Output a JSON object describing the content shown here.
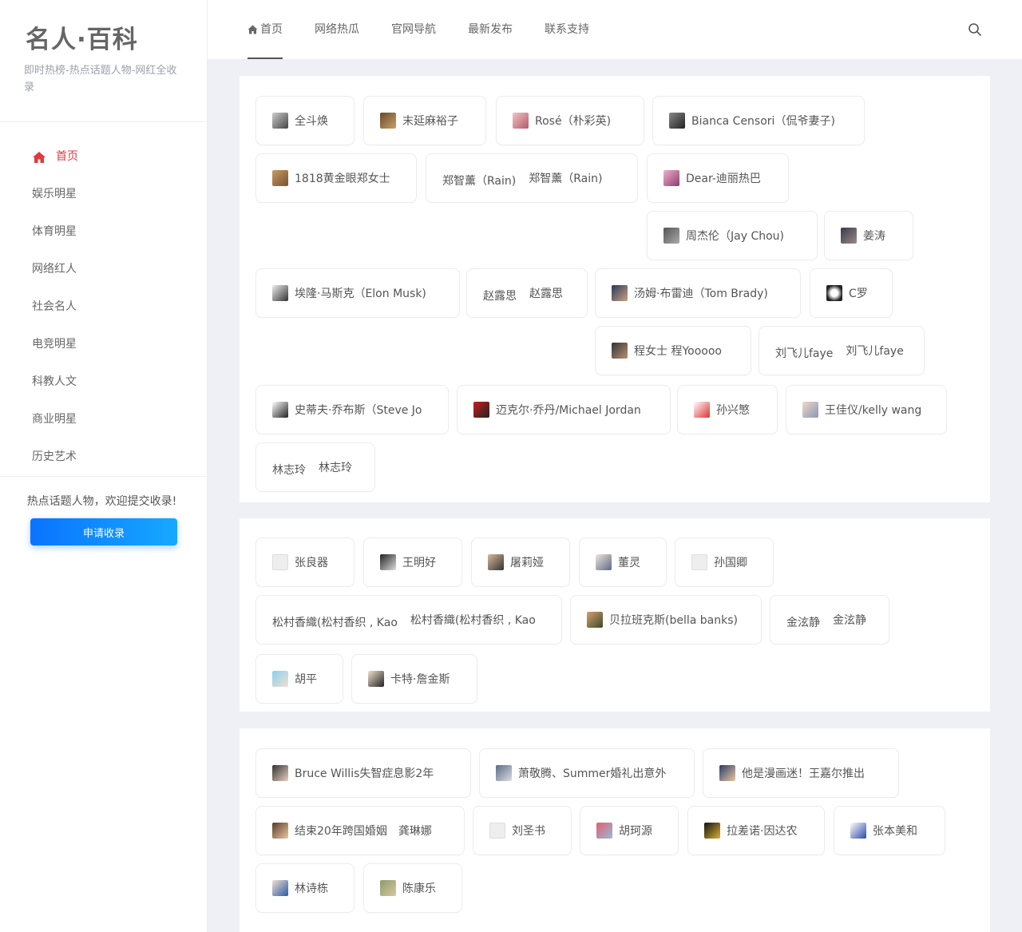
{
  "brand": {
    "title": "名人·百科",
    "subtitle": "即时热榜-热点话题人物-网红全收录"
  },
  "sidebar": {
    "items": [
      {
        "label": "首页",
        "active": true
      },
      {
        "label": "娱乐明星"
      },
      {
        "label": "体育明星"
      },
      {
        "label": "网络红人"
      },
      {
        "label": "社会名人"
      },
      {
        "label": "电竞明星"
      },
      {
        "label": "科教人文"
      },
      {
        "label": "商业明星"
      },
      {
        "label": "历史艺术"
      }
    ],
    "notice": "热点话题人物，欢迎提交收录!",
    "apply_label": "申请收录"
  },
  "topnav": {
    "items": [
      "首页",
      "网络热瓜",
      "官网导航",
      "最新发布",
      "联系支持"
    ]
  },
  "colors": {
    "accent": "#e0393e",
    "button_start": "#0a73ff",
    "button_end": "#16a8ff"
  },
  "cards": [
    {
      "tags": [
        {
          "label": "全斗焕"
        },
        {
          "label": "末延麻裕子"
        },
        {
          "label": "Rosé（朴彩英)"
        },
        {
          "label": "Bianca Censori（侃爷妻子)"
        },
        {
          "label": "1818黄金眼郑女士"
        },
        {
          "pre": "郑智薰（Rain)",
          "label": "郑智薰（Rain)"
        },
        {
          "label": "Dear-迪丽热巴"
        },
        {
          "label": "周杰伦（Jay Chou)"
        },
        {
          "label": "姜涛"
        },
        {
          "label": "埃隆·马斯克（Elon Musk)"
        },
        {
          "pre": "赵露思",
          "label": "赵露思"
        },
        {
          "label": "汤姆·布雷迪（Tom Brady)"
        },
        {
          "label": "C罗"
        },
        {
          "label": "程女士 程Yooooo"
        },
        {
          "pre": "刘飞儿faye",
          "label": "刘飞儿faye"
        },
        {
          "label": "史蒂夫·乔布斯（Steve Jo"
        },
        {
          "label": "迈克尔·乔丹/Michael Jordan"
        },
        {
          "label": "孙兴慜"
        },
        {
          "label": "王佳仪/kelly wang"
        },
        {
          "pre": "林志玲",
          "label": "林志玲"
        }
      ]
    },
    {
      "tags": [
        {
          "label": "张良器"
        },
        {
          "label": "王明好"
        },
        {
          "label": "屠莉娅"
        },
        {
          "label": "董灵"
        },
        {
          "label": "孙国卿"
        },
        {
          "pre": "松村香織(松村香织 , Kao",
          "label": "松村香織(松村香织 , Kao"
        },
        {
          "label": "贝拉班克斯(bella banks)"
        },
        {
          "pre": "金泫静",
          "label": "金泫静"
        },
        {
          "label": "胡平"
        },
        {
          "label": "卡特·詹金斯"
        }
      ]
    },
    {
      "tags": [
        {
          "label": "Bruce Willis失智症息影2年"
        },
        {
          "label": "萧敬腾、Summer婚礼出意外"
        },
        {
          "label": "他是漫画迷！王嘉尔推出"
        },
        {
          "label": "结束20年跨国婚姻　龚琳娜"
        },
        {
          "label": "刘圣书"
        },
        {
          "label": "胡珂源"
        },
        {
          "label": "拉差诺·因达农"
        },
        {
          "label": "张本美和"
        },
        {
          "label": "林诗栋"
        },
        {
          "label": "陈康乐"
        }
      ]
    }
  ]
}
